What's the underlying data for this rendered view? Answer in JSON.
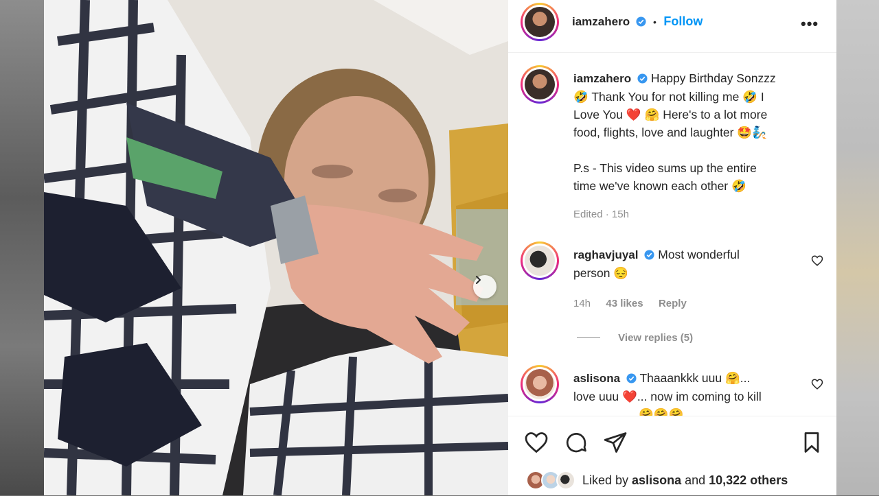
{
  "post": {
    "username": "iamzahero",
    "separator": "•",
    "follow_label": "Follow",
    "more_label": "•••"
  },
  "caption": {
    "username": "iamzahero",
    "lines": [
      "Happy Birthday Sonzzz",
      "🤣 Thank You for not killing me 🤣 I",
      "Love You ❤️ 🤗 Here's to a lot more",
      "food, flights, love and laughter 🤩🧞",
      "P.s - This video sums up the entire",
      "time we've known each other 🤣"
    ],
    "edited": "Edited",
    "dot": "·",
    "time": "15h"
  },
  "comments": [
    {
      "username": "raghavjuyal",
      "text_line1": "Most wonderful",
      "text_line2": "person 😔",
      "time": "14h",
      "likes": "43 likes",
      "reply": "Reply",
      "view_replies": "View replies (5)"
    },
    {
      "username": "aslisona",
      "text_line1": "Thaaankkk uuu 🤗...",
      "text_line2": "love uuu ❤️... now im coming to kill",
      "text_line3": "🤗🤗🤗"
    }
  ],
  "likes": {
    "prefix": "Liked by ",
    "user": "aslisona",
    "middle": " and ",
    "count": "10,322 others"
  },
  "icons": [
    "verified-icon",
    "more-icon",
    "heart-icon",
    "comment-icon",
    "share-icon",
    "bookmark-icon",
    "chevron-right-icon"
  ],
  "colors": {
    "follow_blue": "#0095f6",
    "verified_blue": "#3897f0",
    "meta_gray": "#8e8e8e"
  }
}
